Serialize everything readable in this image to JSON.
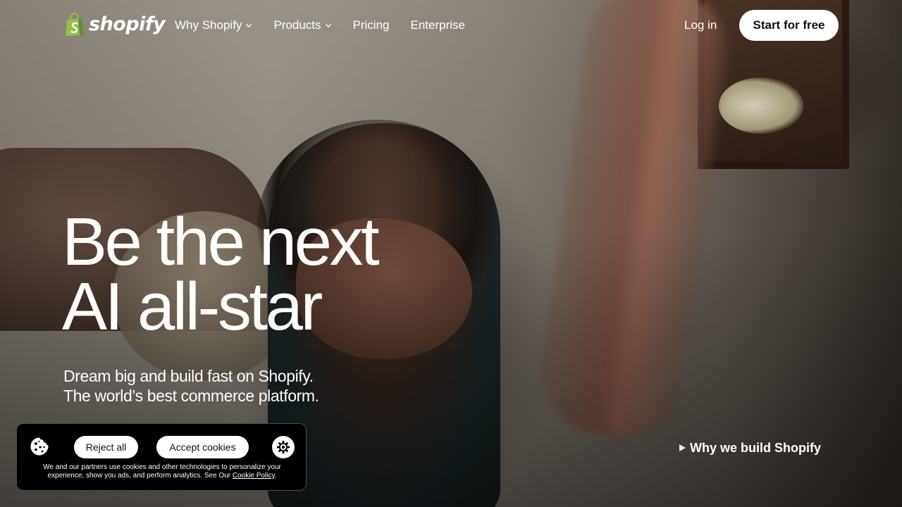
{
  "brand": {
    "name": "shopify",
    "bag_color": "#95bf47",
    "bag_dark": "#5e8e3e"
  },
  "nav": {
    "links": [
      {
        "label": "Why Shopify",
        "has_dropdown": true
      },
      {
        "label": "Products",
        "has_dropdown": true
      },
      {
        "label": "Pricing",
        "has_dropdown": false
      },
      {
        "label": "Enterprise",
        "has_dropdown": false
      }
    ],
    "login_label": "Log in",
    "cta_label": "Start for free"
  },
  "hero": {
    "headline_line1": "Be the next",
    "headline_line2": "AI all-star",
    "subhead_line1": "Dream big and build fast on Shopify.",
    "subhead_line2": "The world’s best commerce platform.",
    "video_link_label": "Why we build Shopify"
  },
  "cookie_banner": {
    "reject_label": "Reject all",
    "accept_label": "Accept cookies",
    "message_line1": "We and our partners use cookies and other technologies to personalize your",
    "message_line2": "experience, show you ads, and perform analytics. See Our ",
    "policy_link": "Cookie Policy",
    "message_end": "."
  }
}
